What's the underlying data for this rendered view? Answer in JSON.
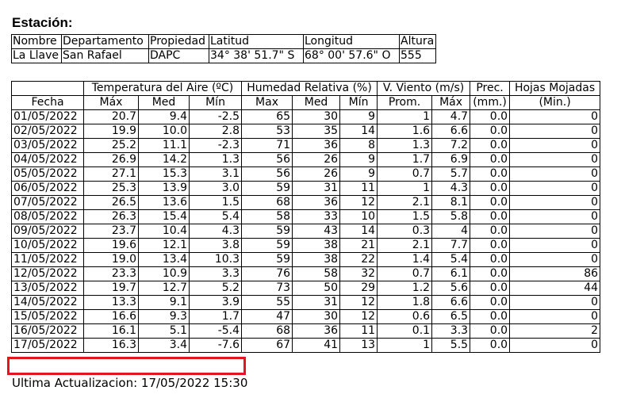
{
  "station": {
    "heading": "Estación:",
    "headers": [
      "Nombre",
      "Departamento",
      "Propiedad",
      "Latitud",
      "Longitud",
      "Altura"
    ],
    "values": [
      "La Llave",
      "San Rafael",
      "DAPC",
      "34° 38' 51.7\" S",
      "68° 00' 57.6\" O",
      "555"
    ]
  },
  "table": {
    "group_headers": {
      "temperature": "Temperatura del Aire (ºC)",
      "humidity": "Humedad Relativa (%)",
      "wind": "V. Viento (m/s)",
      "precip": "Prec.",
      "leaves": "Hojas Mojadas"
    },
    "sub_headers": [
      "Fecha",
      "Máx",
      "Med",
      "Mín",
      "Max",
      "Med",
      "Mín",
      "Prom.",
      "Máx",
      "(mm.)",
      "(Min.)"
    ],
    "rows": [
      [
        "01/05/2022",
        "20.7",
        "9.4",
        "-2.5",
        "65",
        "30",
        "9",
        "1",
        "4.7",
        "0.0",
        "0"
      ],
      [
        "02/05/2022",
        "19.9",
        "10.0",
        "2.8",
        "53",
        "35",
        "14",
        "1.6",
        "6.6",
        "0.0",
        "0"
      ],
      [
        "03/05/2022",
        "25.2",
        "11.1",
        "-2.3",
        "71",
        "36",
        "8",
        "1.3",
        "7.2",
        "0.0",
        "0"
      ],
      [
        "04/05/2022",
        "26.9",
        "14.2",
        "1.3",
        "56",
        "26",
        "9",
        "1.7",
        "6.9",
        "0.0",
        "0"
      ],
      [
        "05/05/2022",
        "27.1",
        "15.3",
        "3.1",
        "56",
        "26",
        "9",
        "0.7",
        "5.7",
        "0.0",
        "0"
      ],
      [
        "06/05/2022",
        "25.3",
        "13.9",
        "3.0",
        "59",
        "31",
        "11",
        "1",
        "4.3",
        "0.0",
        "0"
      ],
      [
        "07/05/2022",
        "26.5",
        "13.6",
        "1.5",
        "68",
        "36",
        "12",
        "2.1",
        "8.1",
        "0.0",
        "0"
      ],
      [
        "08/05/2022",
        "26.3",
        "15.4",
        "5.4",
        "58",
        "33",
        "10",
        "1.5",
        "5.8",
        "0.0",
        "0"
      ],
      [
        "09/05/2022",
        "23.7",
        "10.4",
        "4.3",
        "59",
        "43",
        "14",
        "0.3",
        "4",
        "0.0",
        "0"
      ],
      [
        "10/05/2022",
        "19.6",
        "12.1",
        "3.8",
        "59",
        "38",
        "21",
        "2.1",
        "7.7",
        "0.0",
        "0"
      ],
      [
        "11/05/2022",
        "19.0",
        "13.4",
        "10.3",
        "59",
        "38",
        "22",
        "1.4",
        "5.4",
        "0.0",
        "0"
      ],
      [
        "12/05/2022",
        "23.3",
        "10.9",
        "3.3",
        "76",
        "58",
        "32",
        "0.7",
        "6.1",
        "0.0",
        "86"
      ],
      [
        "13/05/2022",
        "19.7",
        "12.7",
        "5.2",
        "73",
        "50",
        "29",
        "1.2",
        "5.6",
        "0.0",
        "44"
      ],
      [
        "14/05/2022",
        "13.3",
        "9.1",
        "3.9",
        "55",
        "31",
        "12",
        "1.8",
        "6.6",
        "0.0",
        "0"
      ],
      [
        "15/05/2022",
        "16.6",
        "9.3",
        "1.7",
        "47",
        "30",
        "12",
        "0.6",
        "6.5",
        "0.0",
        "0"
      ],
      [
        "16/05/2022",
        "16.1",
        "5.1",
        "-5.4",
        "68",
        "36",
        "11",
        "0.1",
        "3.3",
        "0.0",
        "2"
      ],
      [
        "17/05/2022",
        "16.3",
        "3.4",
        "-7.6",
        "67",
        "41",
        "13",
        "1",
        "5.5",
        "0.0",
        "0"
      ]
    ]
  },
  "last_update": "Ultima Actualizacion: 17/05/2022 15:30",
  "colors": {
    "highlight": "#e3151e"
  }
}
